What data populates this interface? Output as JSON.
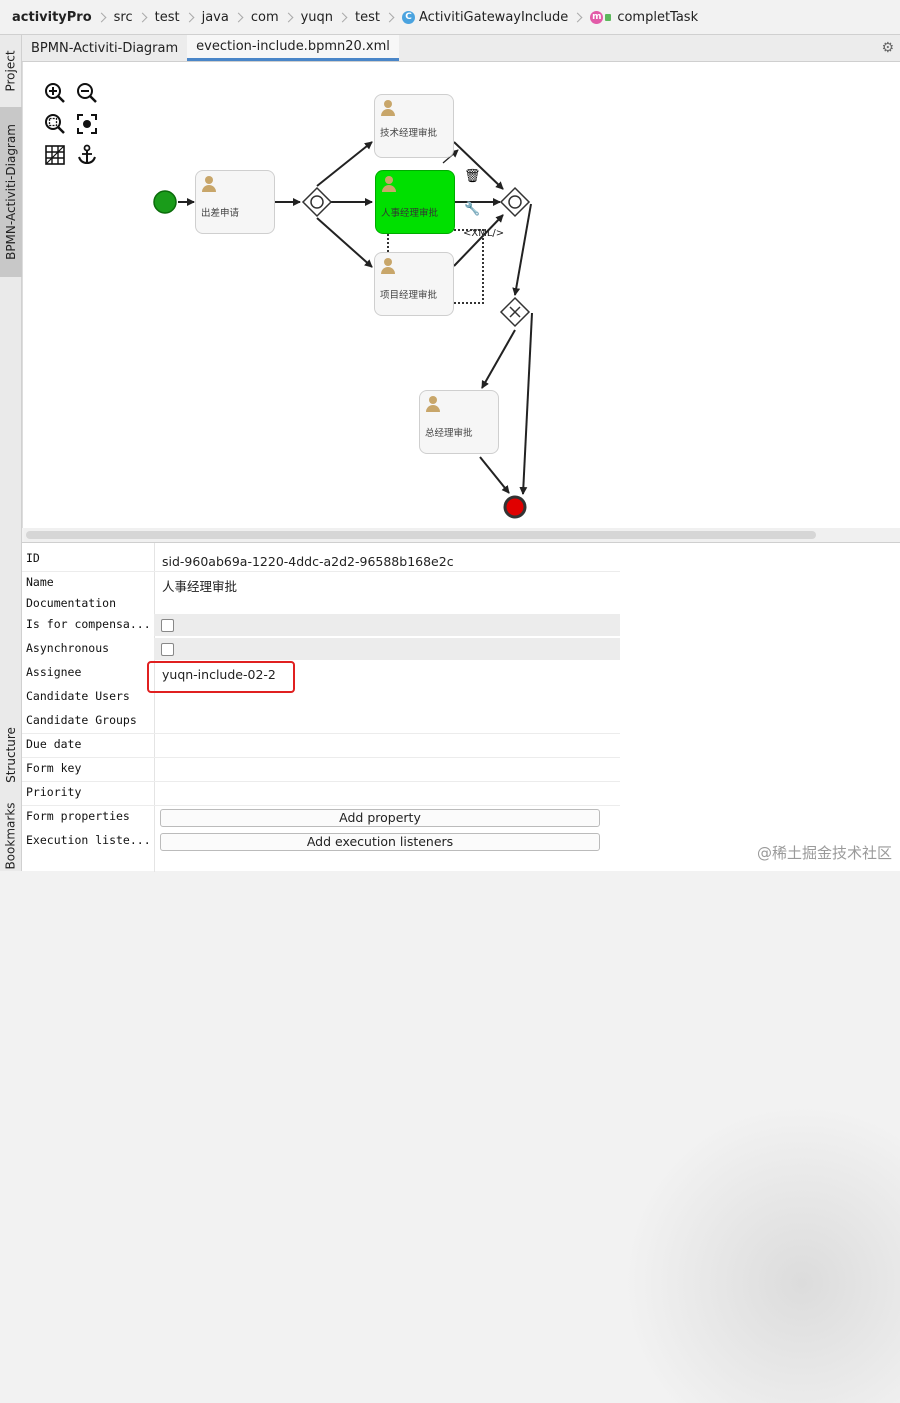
{
  "breadcrumb": {
    "items": [
      "activityPro",
      "src",
      "test",
      "java",
      "com",
      "yuqn",
      "test",
      "ActivitiGatewayInclude",
      "completTask"
    ],
    "class_icon": "C",
    "method_icon": "m"
  },
  "left_strip": {
    "project": "Project",
    "diagram": "BPMN-Activiti-Diagram",
    "structure": "Structure",
    "bookmarks": "Bookmarks"
  },
  "tabs": [
    {
      "label": "BPMN-Activiti-Diagram",
      "active": false
    },
    {
      "label": "evection-include.bpmn20.xml",
      "active": true
    }
  ],
  "diagram": {
    "tasks": {
      "apply": "出差申请",
      "tech": "技术经理审批",
      "hr": "人事经理审批",
      "project": "项目经理审批",
      "general": "总经理审批"
    },
    "xml_hint": "<XML/>"
  },
  "properties": {
    "rows": [
      {
        "label": "ID",
        "value": "sid-960ab69a-1220-4ddc-a2d2-96588b168e2c"
      },
      {
        "label": "Name",
        "value": "人事经理审批"
      },
      {
        "label": "Documentation",
        "value": ""
      },
      {
        "label": "Is for compensa...",
        "value": ""
      },
      {
        "label": "Asynchronous",
        "value": ""
      },
      {
        "label": "Assignee",
        "value": "yuqn-include-02-2"
      },
      {
        "label": "Candidate Users",
        "value": ""
      },
      {
        "label": "Candidate Groups",
        "value": ""
      },
      {
        "label": "Due date",
        "value": ""
      },
      {
        "label": "Form key",
        "value": ""
      },
      {
        "label": "Priority",
        "value": ""
      },
      {
        "label": "Form properties",
        "value": ""
      },
      {
        "label": "Execution liste...",
        "value": ""
      }
    ],
    "add_property_label": "Add property",
    "add_listeners_label": "Add execution listeners"
  },
  "watermark": "@稀土掘金技术社区",
  "colors": {
    "start_event": "#1a9c1a",
    "end_event": "#e00000",
    "selected_task": "#00e000",
    "highlight_box": "#e02020",
    "active_tab_underline": "#4a86c8"
  }
}
